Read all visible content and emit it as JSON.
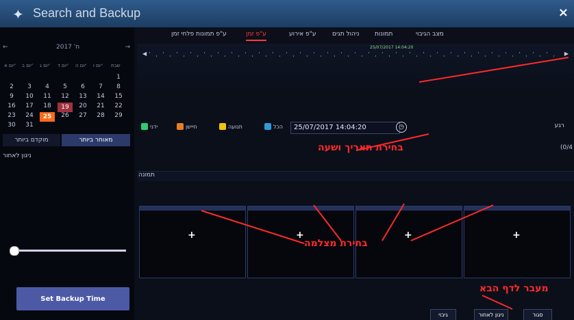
{
  "window": {
    "title": "Search and Backup",
    "close_label": "×"
  },
  "tabs": [
    {
      "label": "ע\"פ תמונות פלחי זמן"
    },
    {
      "label": "ע\"פ זמן"
    },
    {
      "label": "ע\"פ אירוע"
    },
    {
      "label": "ניהול תגים"
    },
    {
      "label": "תמונות"
    },
    {
      "label": "מצב הגיבוי"
    }
  ],
  "calendar": {
    "prev_label": "←",
    "month_label": "ח' 2017",
    "next_label": "→",
    "weekdays": [
      "יום א'",
      "יום ב'",
      "יום ג'",
      "יום ד'",
      "יום ה'",
      "יום ו'",
      "שבת"
    ],
    "rows": [
      [
        "",
        "",
        "",
        "",
        "",
        "",
        "1"
      ],
      [
        "2",
        "3",
        "4",
        "5",
        "6",
        "7",
        "8"
      ],
      [
        "9",
        "10",
        "11",
        "12",
        "13",
        "14",
        "15"
      ],
      [
        "16",
        "17",
        "18",
        "19",
        "20",
        "21",
        "22"
      ],
      [
        "23",
        "24",
        "25",
        "26",
        "27",
        "28",
        "29"
      ],
      [
        "30",
        "31",
        "",
        "",
        "",
        "",
        ""
      ]
    ],
    "selected": "25",
    "recorded": "19"
  },
  "left_panel": {
    "tab_start": "מוקדם ביותר",
    "tab_end": "מאוחר ביותר",
    "list_label": "ניגון לאחור",
    "set_backup": "Set Backup Time"
  },
  "timeline": {
    "date": "25/07/2017 14:04:20",
    "left_label": "◀",
    "right_label": "▶"
  },
  "filters": [
    {
      "label": "ידני",
      "color": "#2ecc71"
    },
    {
      "label": "חיישן",
      "color": "#e67e22"
    },
    {
      "label": "תנועה",
      "color": "#f1c40f"
    },
    {
      "label": "הכל",
      "color": "#3498db"
    }
  ],
  "search": {
    "datetime": "25/07/2017 14:04:20",
    "type_label": "רגע",
    "count": "(0/4"
  },
  "grid": {
    "header": "תמונה"
  },
  "buttons": {
    "backup": "גיבוי",
    "playback": "ניגון לאחור",
    "close": "סגור"
  },
  "annotations": {
    "date_time": "בחירת תאריך ושעה",
    "camera": "בחירת מצלמה",
    "next_page": "מעבר לדף הבא"
  },
  "colors": {
    "accent": "#ff3a3a",
    "titlebar": "#2f5b8c"
  }
}
